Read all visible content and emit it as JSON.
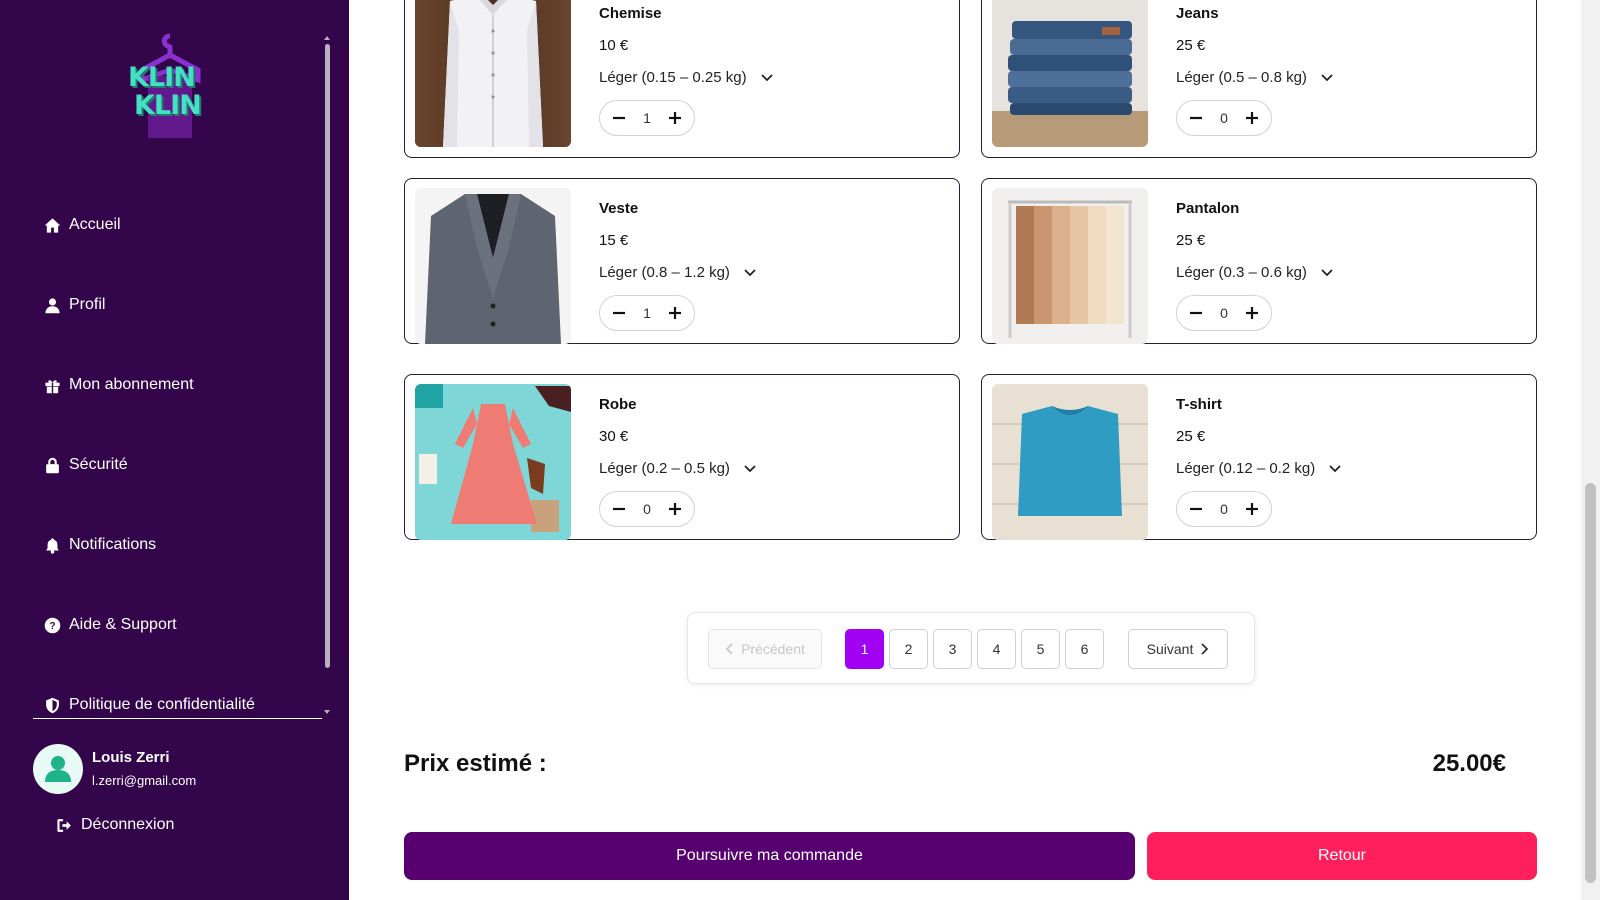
{
  "sidebar": {
    "logo_line1": "KLIN",
    "logo_line2": "KLIN",
    "items": [
      {
        "label": "Accueil",
        "icon": "home-icon"
      },
      {
        "label": "Profil",
        "icon": "user-icon"
      },
      {
        "label": "Mon abonnement",
        "icon": "gift-icon"
      },
      {
        "label": "Sécurité",
        "icon": "lock-icon"
      },
      {
        "label": "Notifications",
        "icon": "bell-icon"
      },
      {
        "label": "Aide & Support",
        "icon": "help-icon"
      },
      {
        "label": "Politique de confidentialité",
        "icon": "shield-icon"
      }
    ],
    "user": {
      "name": "Louis Zerri",
      "email": "l.zerri@gmail.com"
    },
    "logout_label": "Déconnexion"
  },
  "products": [
    {
      "name": "Chemise",
      "price": "10 €",
      "weight": "Léger (0.15 – 0.25 kg)",
      "qty": "1",
      "image": "white-shirt"
    },
    {
      "name": "Jeans",
      "price": "25 €",
      "weight": "Léger (0.5 – 0.8 kg)",
      "qty": "0",
      "image": "folded-jeans"
    },
    {
      "name": "Veste",
      "price": "15 €",
      "weight": "Léger (0.8 – 1.2 kg)",
      "qty": "1",
      "image": "grey-blazer"
    },
    {
      "name": "Pantalon",
      "price": "25 €",
      "weight": "Léger (0.3 – 0.6 kg)",
      "qty": "0",
      "image": "trousers-rack"
    },
    {
      "name": "Robe",
      "price": "30 €",
      "weight": "Léger (0.2 – 0.5 kg)",
      "qty": "0",
      "image": "pink-dress"
    },
    {
      "name": "T-shirt",
      "price": "25 €",
      "weight": "Léger (0.12 – 0.2 kg)",
      "qty": "0",
      "image": "blue-tshirt"
    }
  ],
  "pagination": {
    "prev_label": "Précédent",
    "next_label": "Suivant",
    "pages": [
      "1",
      "2",
      "3",
      "4",
      "5",
      "6"
    ],
    "current": "1"
  },
  "estimate": {
    "label": "Prix estimé :",
    "value": "25.00€"
  },
  "actions": {
    "continue_label": "Poursuivre ma commande",
    "back_label": "Retour"
  },
  "colors": {
    "sidebar": "#33054b",
    "primary": "#570070",
    "accent": "#a100f2",
    "back": "#ff1f5c",
    "logo": "#45e0c4"
  }
}
